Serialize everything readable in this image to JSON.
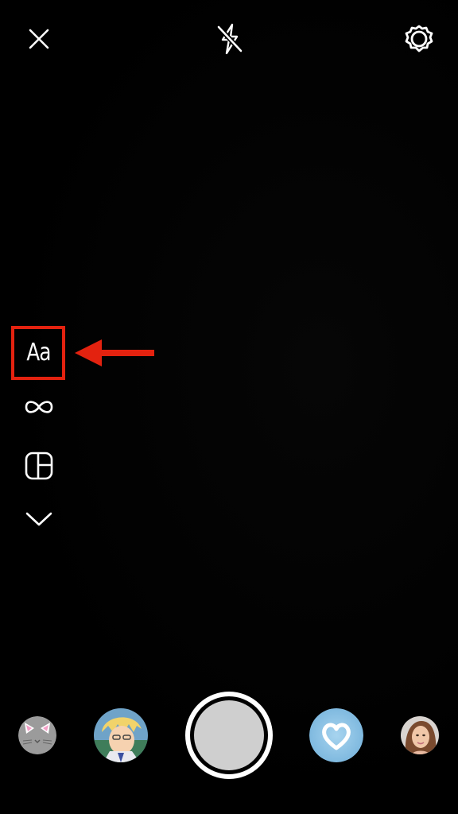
{
  "top_bar": {
    "close_icon": "close-icon",
    "flash_icon": "flash-off-icon",
    "settings_icon": "settings-gear-icon"
  },
  "side_tools": {
    "text_tool_label": "Aa",
    "items": [
      "text-tool",
      "boomerang-infinity-icon",
      "layout-grid-icon",
      "chevron-down-icon"
    ]
  },
  "annotation": {
    "highlight_color": "#e3220f",
    "arrow_color": "#e3220f"
  },
  "bottom_bar": {
    "filters": [
      "cat-ears-filter",
      "anime-character-filter",
      "heart-filter",
      "face-filter"
    ],
    "shutter_color": "#cfcfcf"
  }
}
